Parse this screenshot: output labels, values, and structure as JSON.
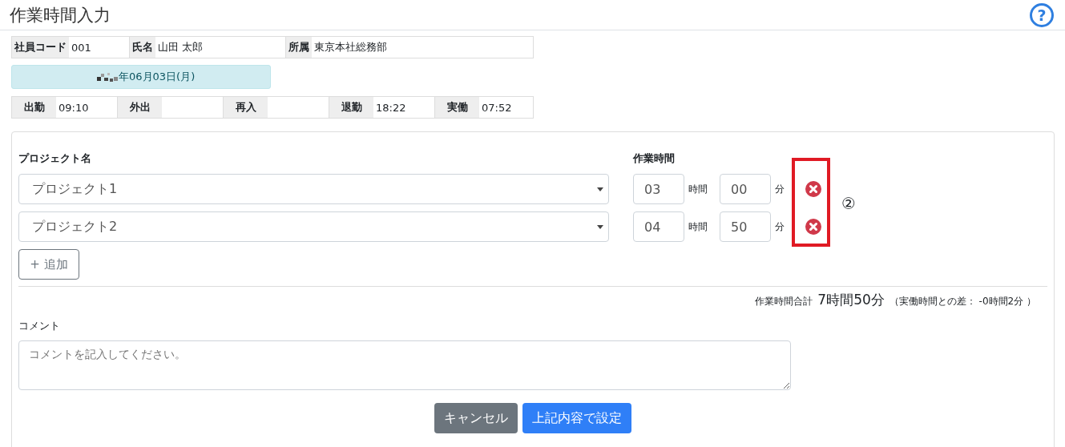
{
  "title": "作業時間入力",
  "help_button": "?",
  "employee": [
    {
      "label": "社員コード",
      "value": "001"
    },
    {
      "label": "氏名",
      "value": "山田 太郎"
    },
    {
      "label": "所属",
      "value": "東京本社総務部"
    }
  ],
  "date": {
    "redacted": true,
    "text": "年06月03日(月)"
  },
  "times": [
    {
      "label": "出勤",
      "value": "09:10"
    },
    {
      "label": "外出"
    },
    {
      "label": "再入"
    },
    {
      "label": "退勤",
      "value": "18:22"
    },
    {
      "label": "実働",
      "value": "07:52"
    }
  ],
  "form": {
    "project_header": "プロジェクト名",
    "time_header": "作業時間",
    "rows": [
      {
        "project": "プロジェクト1",
        "hours": "03",
        "hours_unit": "時間",
        "minutes": "00",
        "minutes_unit": "分"
      },
      {
        "project": "プロジェクト2",
        "hours": "04",
        "hours_unit": "時間",
        "minutes": "50",
        "minutes_unit": "分"
      }
    ],
    "add_button": "+ 追加",
    "total_label": "作業時間合計",
    "total_value": "7時間50分",
    "difference": "（実働時間との差： -0時間2分 ）",
    "comment_label": "コメント",
    "comment_placeholder": "コメントを記入してください。",
    "buttons": [
      {
        "label": "キャンセル",
        "kind": "secondary"
      },
      {
        "label": "上記内容で設定",
        "kind": "primary"
      }
    ]
  },
  "annotation": {
    "label": "②"
  }
}
